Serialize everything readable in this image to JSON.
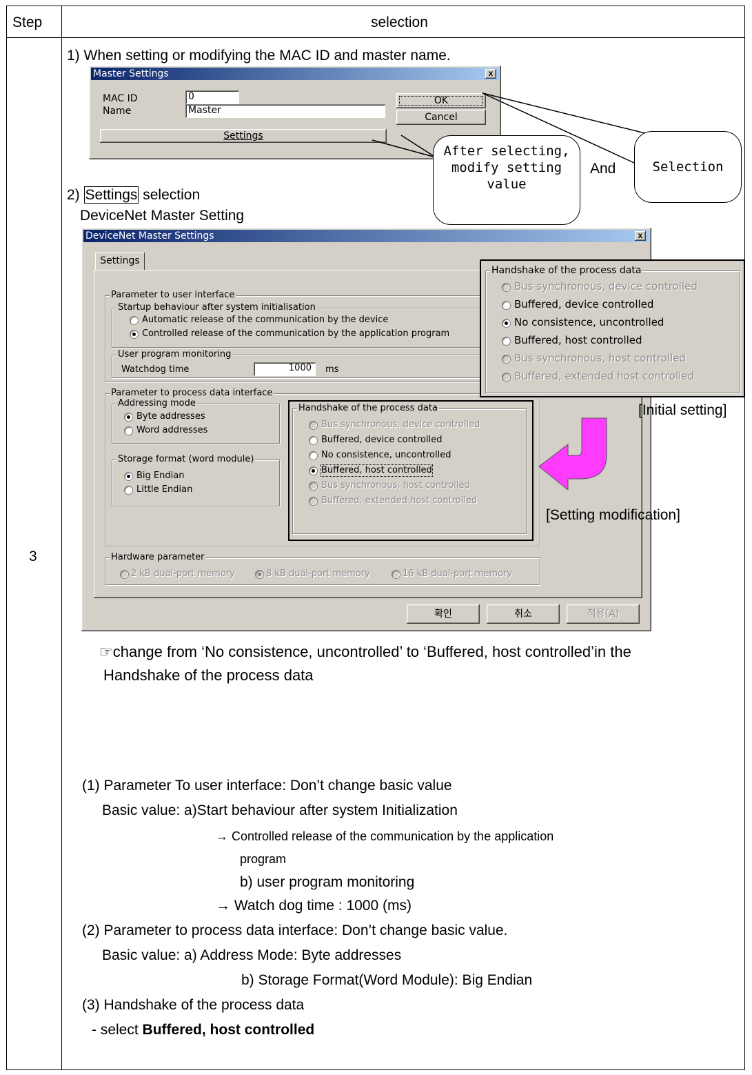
{
  "table": {
    "header_step": "Step",
    "header_selection": "selection",
    "step_number": "3"
  },
  "section1": {
    "heading": "1) When setting or modifying the MAC ID and master name.",
    "dialog": {
      "title": "Master Settings",
      "close": "x",
      "mac_label": "MAC ID",
      "mac_value": "0",
      "name_label": "Name",
      "name_value": "Master",
      "settings_button": "Settings",
      "ok_button": "OK",
      "cancel_button": "Cancel"
    },
    "callout_modify": "After selecting, modify setting value",
    "callout_and": "And",
    "callout_selection": "Selection"
  },
  "section2": {
    "heading_prefix": "2) ",
    "heading_boxed": "Settings",
    "heading_suffix": " selection",
    "subheading": "DeviceNet Master Setting",
    "dialog": {
      "title": "DeviceNet Master Settings",
      "close": "x",
      "tab": "Settings",
      "grp_user_interface": "Parameter to user interface",
      "grp_startup": "Startup behaviour after system initialisation",
      "startup_opt1": "Automatic release of the communication by the device",
      "startup_opt2": "Controlled release of the communication by the application program",
      "grp_monitoring": "User program monitoring",
      "watchdog_label": "Watchdog time",
      "watchdog_value": "1000",
      "watchdog_unit": "ms",
      "grp_process": "Parameter to process data interface",
      "grp_addressing": "Addressing mode",
      "addr_opt1": "Byte addresses",
      "addr_opt2": "Word addresses",
      "grp_storage": "Storage format (word module)",
      "storage_opt1": "Big Endian",
      "storage_opt2": "Little Endian",
      "grp_handshake": "Handshake of the process data",
      "handshake_options": [
        "Bus synchronous, device controlled",
        "Buffered, device controlled",
        "No consistence, uncontrolled",
        "Buffered, host controlled",
        "Bus synchronous, host controlled",
        "Buffered, extended host controlled"
      ],
      "grp_hardware": "Hardware parameter",
      "hw_opt1": "2 kB dual-port memory",
      "hw_opt2": "8 kB dual-port memory",
      "hw_opt3": "16 kB dual-port memory",
      "btn_ok": "확인",
      "btn_cancel": "취소",
      "btn_apply": "적용(A)"
    },
    "initial_popup": {
      "title": "Handshake of the process data",
      "options": [
        "Bus synchronous, device controlled",
        "Buffered, device controlled",
        "No consistence, uncontrolled",
        "Buffered, host controlled",
        "Bus synchronous, host controlled",
        "Buffered, extended host controlled"
      ]
    },
    "label_initial": "[Initial setting]",
    "label_modification": "[Setting modification]",
    "arrow_color": "#ff3bff"
  },
  "notes": {
    "change_line1": "☞change from ‘No consistence, uncontrolled’ to ‘Buffered, host controlled’in the",
    "change_line2": "Handshake of the process data",
    "p1": "(1) Parameter To user interface: Don’t change basic value",
    "p1a": "Basic value: a)Start behaviour after system Initialization",
    "p1b": "→ Controlled release of the communication by the application",
    "p1c": "program",
    "p1d": "b) user program monitoring",
    "p1e": "→ Watch dog time : 1000 (ms)",
    "p2": "(2) Parameter to process data interface: Don’t change basic value.",
    "p2a": "Basic value: a) Address Mode: Byte addresses",
    "p2b": "b) Storage Format(Word Module): Big Endian",
    "p3": "(3) Handshake of the process data",
    "p3a_prefix": "- select ",
    "p3a_bold": "Buffered, host controlled"
  }
}
